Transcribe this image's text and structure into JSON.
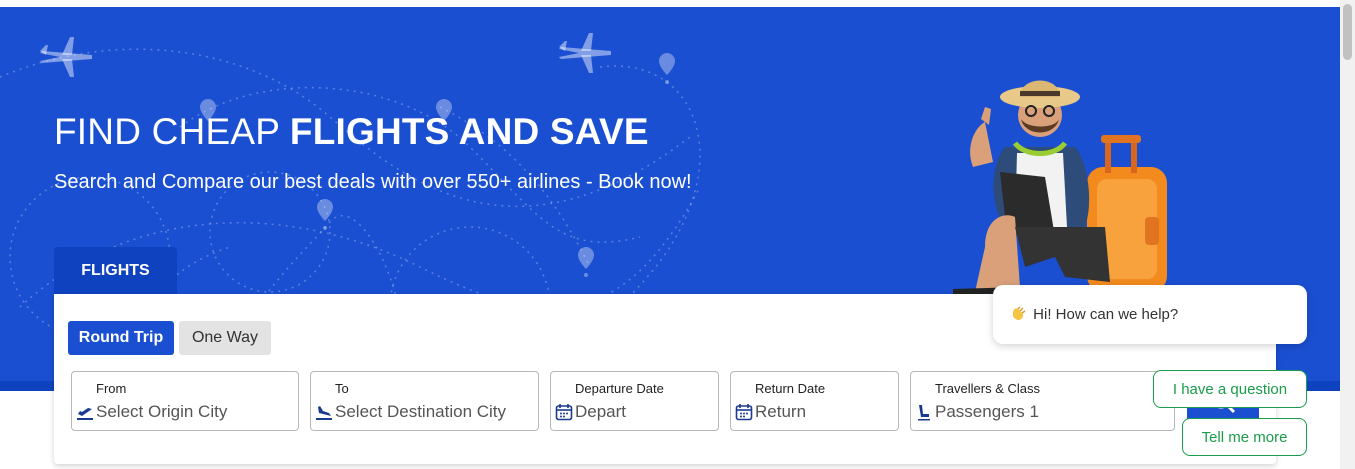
{
  "hero": {
    "title_light": "FIND CHEAP ",
    "title_bold": "FLIGHTS AND SAVE",
    "subtitle": "Search and Compare our best deals with over 550+ airlines - Book now!"
  },
  "tabs": [
    {
      "label": "FLIGHTS",
      "active": true
    }
  ],
  "trip_type": {
    "options": [
      "Round Trip",
      "One Way"
    ],
    "selected": "Round Trip"
  },
  "fields": {
    "from": {
      "label": "From",
      "placeholder": "Select Origin City",
      "icon": "plane-takeoff-icon"
    },
    "to": {
      "label": "To",
      "placeholder": "Select Destination City",
      "icon": "plane-landing-icon"
    },
    "departure": {
      "label": "Departure Date",
      "placeholder": "Depart",
      "icon": "calendar-icon"
    },
    "return": {
      "label": "Return Date",
      "placeholder": "Return",
      "icon": "calendar-icon"
    },
    "travellers": {
      "label": "Travellers & Class",
      "value": "Passengers 1",
      "icon": "seat-icon"
    }
  },
  "chat": {
    "greeting": "Hi! How can we help?",
    "buttons": [
      "I have a question",
      "Tell me more"
    ]
  },
  "colors": {
    "hero_blue": "#1a4fd1",
    "dark_blue": "#0f42bf",
    "chat_green": "#1a9c4a"
  }
}
